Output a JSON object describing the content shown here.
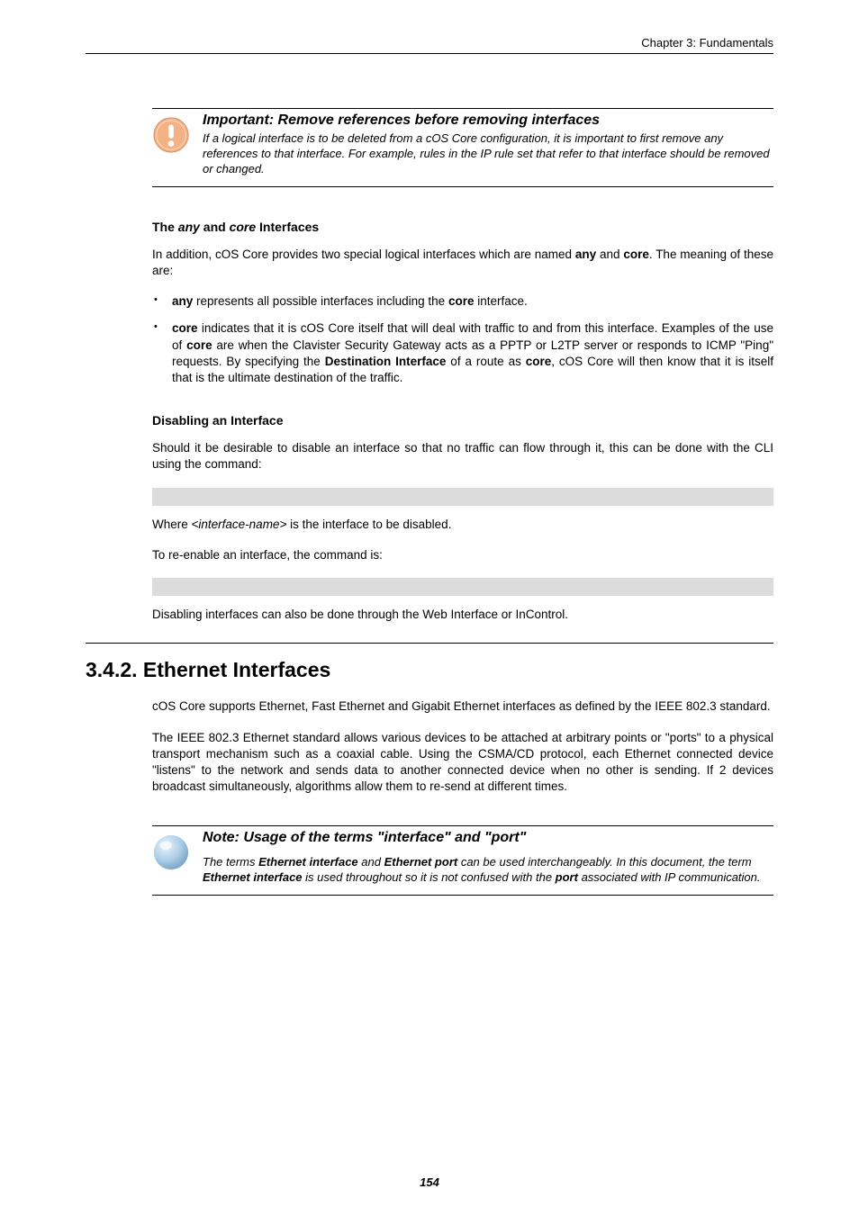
{
  "header": {
    "chapter": "Chapter 3: Fundamentals"
  },
  "callout1": {
    "title": "Important: Remove references before removing interfaces",
    "text": "If a logical interface is to be deleted from a cOS Core configuration, it is important to first remove any references to that interface. For example, rules in the IP rule set that refer to that interface should be removed or changed."
  },
  "sec_anycore": {
    "heading_pre": "The ",
    "heading_any": "any",
    "heading_mid": " and ",
    "heading_core": "core",
    "heading_post": " Interfaces",
    "intro_pre": "In addition, cOS Core provides two special logical interfaces which are named ",
    "intro_any": "any",
    "intro_mid": " and ",
    "intro_core": "core",
    "intro_post": ". The meaning of these are:",
    "bullet1_b1": "any",
    "bullet1_mid": " represents all possible interfaces including the ",
    "bullet1_b2": "core",
    "bullet1_post": " interface.",
    "bullet2_b1": "core",
    "bullet2_t1": " indicates that it is cOS Core itself that will deal with traffic to and from this interface. Examples of the use of ",
    "bullet2_b2": "core",
    "bullet2_t2": " are when the Clavister Security Gateway acts as a PPTP or L2TP server or responds to ICMP \"Ping\" requests. By specifying the ",
    "bullet2_b3": "Destination Interface",
    "bullet2_t3": " of a route as ",
    "bullet2_b4": "core",
    "bullet2_t4": ", cOS Core will then know that it is itself that is the ultimate destination of the traffic."
  },
  "sec_disable": {
    "heading": "Disabling an Interface",
    "p1": "Should it be desirable to disable an interface so that no traffic can flow through it, this can be done with the CLI using the command:",
    "p2_pre": "Where ",
    "p2_it": "<interface-name>",
    "p2_post": " is the interface to be disabled.",
    "p3": "To re-enable an interface, the command is:",
    "p4": "Disabling interfaces can also be done through the Web Interface or InControl."
  },
  "sec_ethernet": {
    "heading": "3.4.2. Ethernet Interfaces",
    "p1": "cOS Core supports Ethernet, Fast Ethernet and Gigabit Ethernet interfaces as defined by the IEEE 802.3 standard.",
    "p2": "The IEEE 802.3 Ethernet standard allows various devices to be attached at arbitrary points or \"ports\" to a physical transport mechanism such as a coaxial cable. Using the CSMA/CD protocol, each Ethernet connected device \"listens\" to the network and sends data to another connected device when no other is sending. If 2 devices broadcast simultaneously, algorithms allow them to re-send at different times."
  },
  "callout2": {
    "title": "Note: Usage of the terms \"interface\" and \"port\"",
    "t1": "The terms ",
    "b1": "Ethernet interface",
    "t2": " and ",
    "b2": "Ethernet port",
    "t3": " can be used interchangeably. In this document, the term ",
    "b3": "Ethernet interface",
    "t4": " is used throughout so it is not confused with the ",
    "b4": "port",
    "t5": " associated with IP communication."
  },
  "pagenum": "154"
}
